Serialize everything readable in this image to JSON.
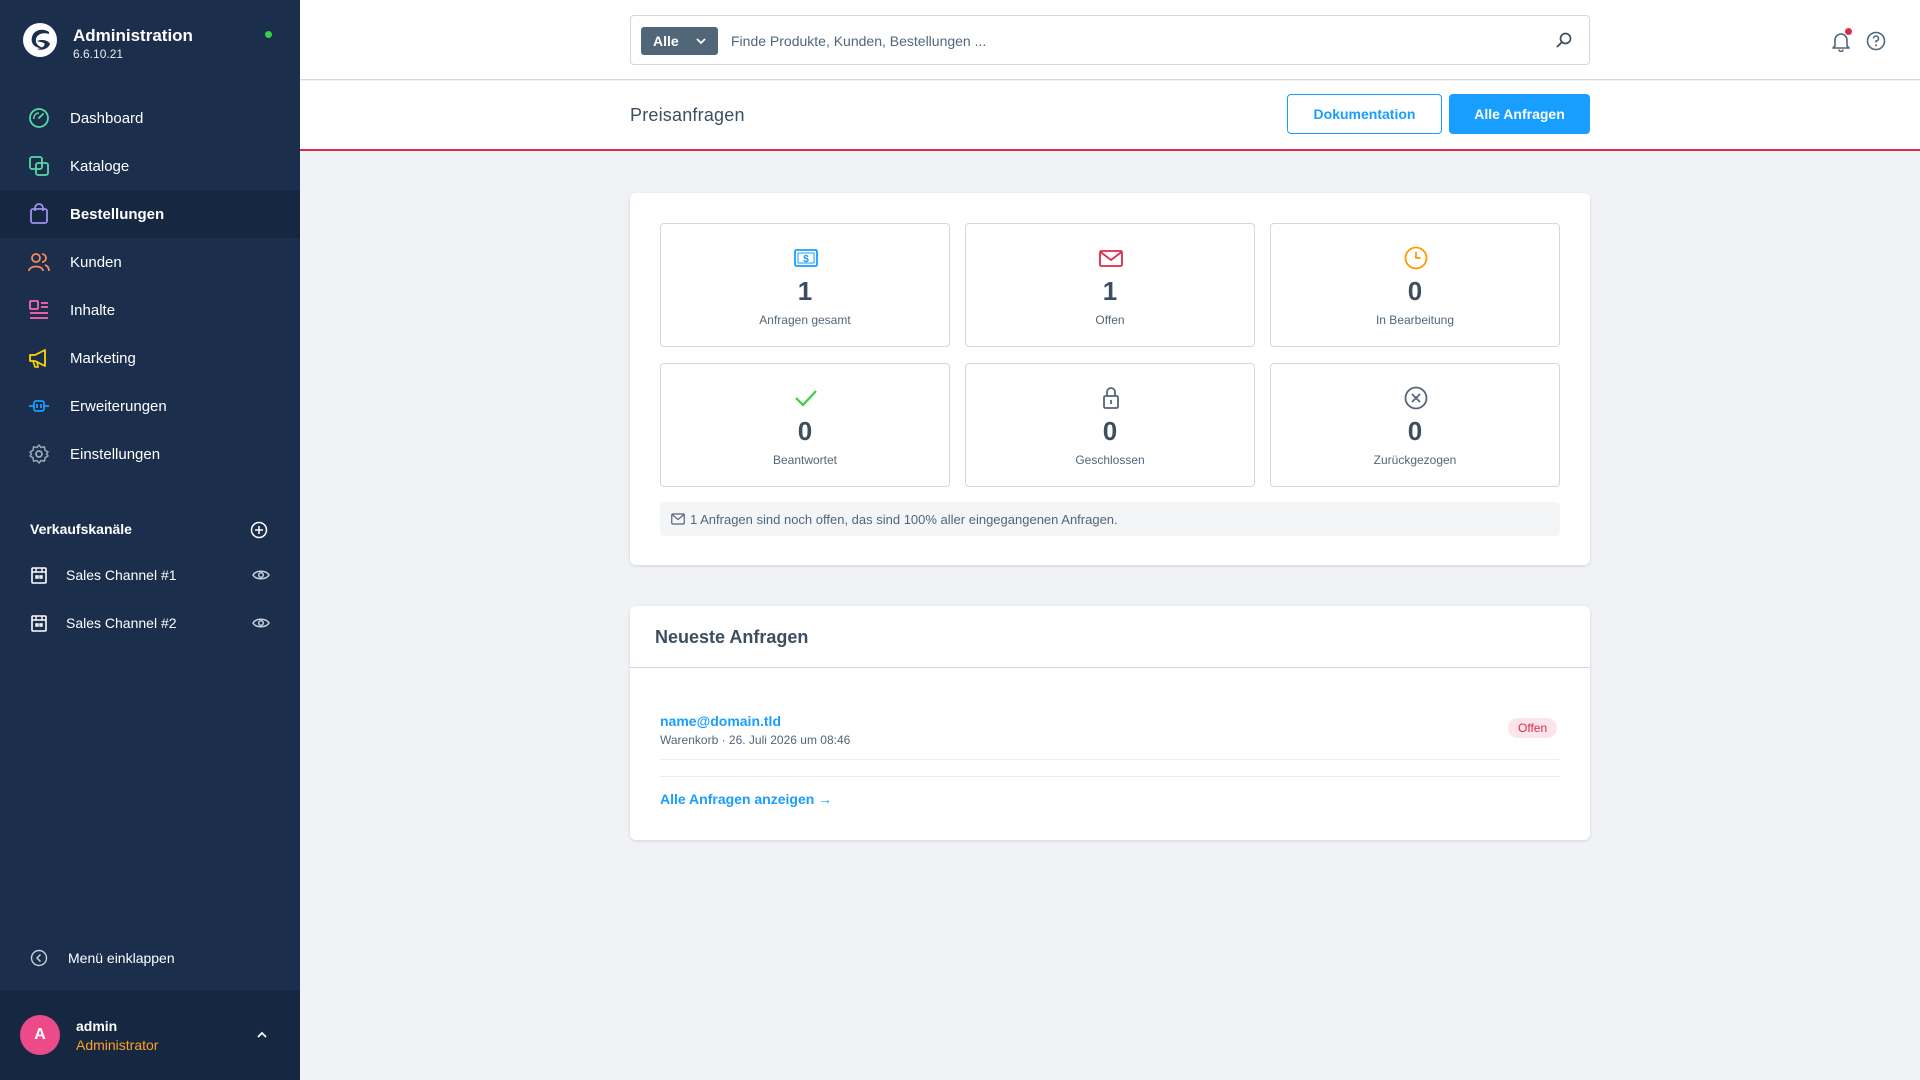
{
  "app": {
    "title": "Administration",
    "version": "6.6.10.21"
  },
  "nav": {
    "items": [
      {
        "label": "Dashboard",
        "icon": "gauge-icon",
        "color": "#57d9a3"
      },
      {
        "label": "Kataloge",
        "icon": "catalog-icon",
        "color": "#57d9a3"
      },
      {
        "label": "Bestellungen",
        "icon": "shopping-bag-icon",
        "color": "#a092f0",
        "active": true
      },
      {
        "label": "Kunden",
        "icon": "users-icon",
        "color": "#f88962"
      },
      {
        "label": "Inhalte",
        "icon": "content-icon",
        "color": "#ff68b4"
      },
      {
        "label": "Marketing",
        "icon": "megaphone-icon",
        "color": "#ffd700"
      },
      {
        "label": "Erweiterungen",
        "icon": "plug-icon",
        "color": "#189eff"
      },
      {
        "label": "Einstellungen",
        "icon": "gear-icon",
        "color": "#9aa8b5"
      }
    ]
  },
  "channels": {
    "title": "Verkaufskanäle",
    "items": [
      {
        "label": "Sales Channel #1"
      },
      {
        "label": "Sales Channel #2"
      }
    ]
  },
  "collapse_label": "Menü einklappen",
  "user": {
    "initial": "A",
    "name": "admin",
    "role": "Administrator"
  },
  "search": {
    "type": "Alle",
    "placeholder": "Finde Produkte, Kunden, Bestellungen ..."
  },
  "page": {
    "title": "Preisanfragen",
    "doc_button": "Dokumentation",
    "all_button": "Alle Anfragen"
  },
  "stats": [
    {
      "value": "1",
      "label": "Anfragen gesamt",
      "icon": "money-icon",
      "color": "#189eff"
    },
    {
      "value": "1",
      "label": "Offen",
      "icon": "envelope-icon",
      "color": "#de294c"
    },
    {
      "value": "0",
      "label": "In Bearbeitung",
      "icon": "clock-icon",
      "color": "#ff9800"
    },
    {
      "value": "0",
      "label": "Beantwortet",
      "icon": "checkmark-icon",
      "color": "#37d046"
    },
    {
      "value": "0",
      "label": "Geschlossen",
      "icon": "lock-icon",
      "color": "#52667a"
    },
    {
      "value": "0",
      "label": "Zurückgezogen",
      "icon": "x-circle-icon",
      "color": "#52667a"
    }
  ],
  "summary_note": "1 Anfragen sind noch offen, das sind 100% aller eingegangenen Anfragen.",
  "latest": {
    "title": "Neueste Anfragen",
    "requests": [
      {
        "email": "name@domain.tld",
        "meta": "Warenkorb · 26. Juli 2026 um 08:46",
        "status": "Offen"
      }
    ],
    "all_link": "Alle Anfragen anzeigen →"
  }
}
